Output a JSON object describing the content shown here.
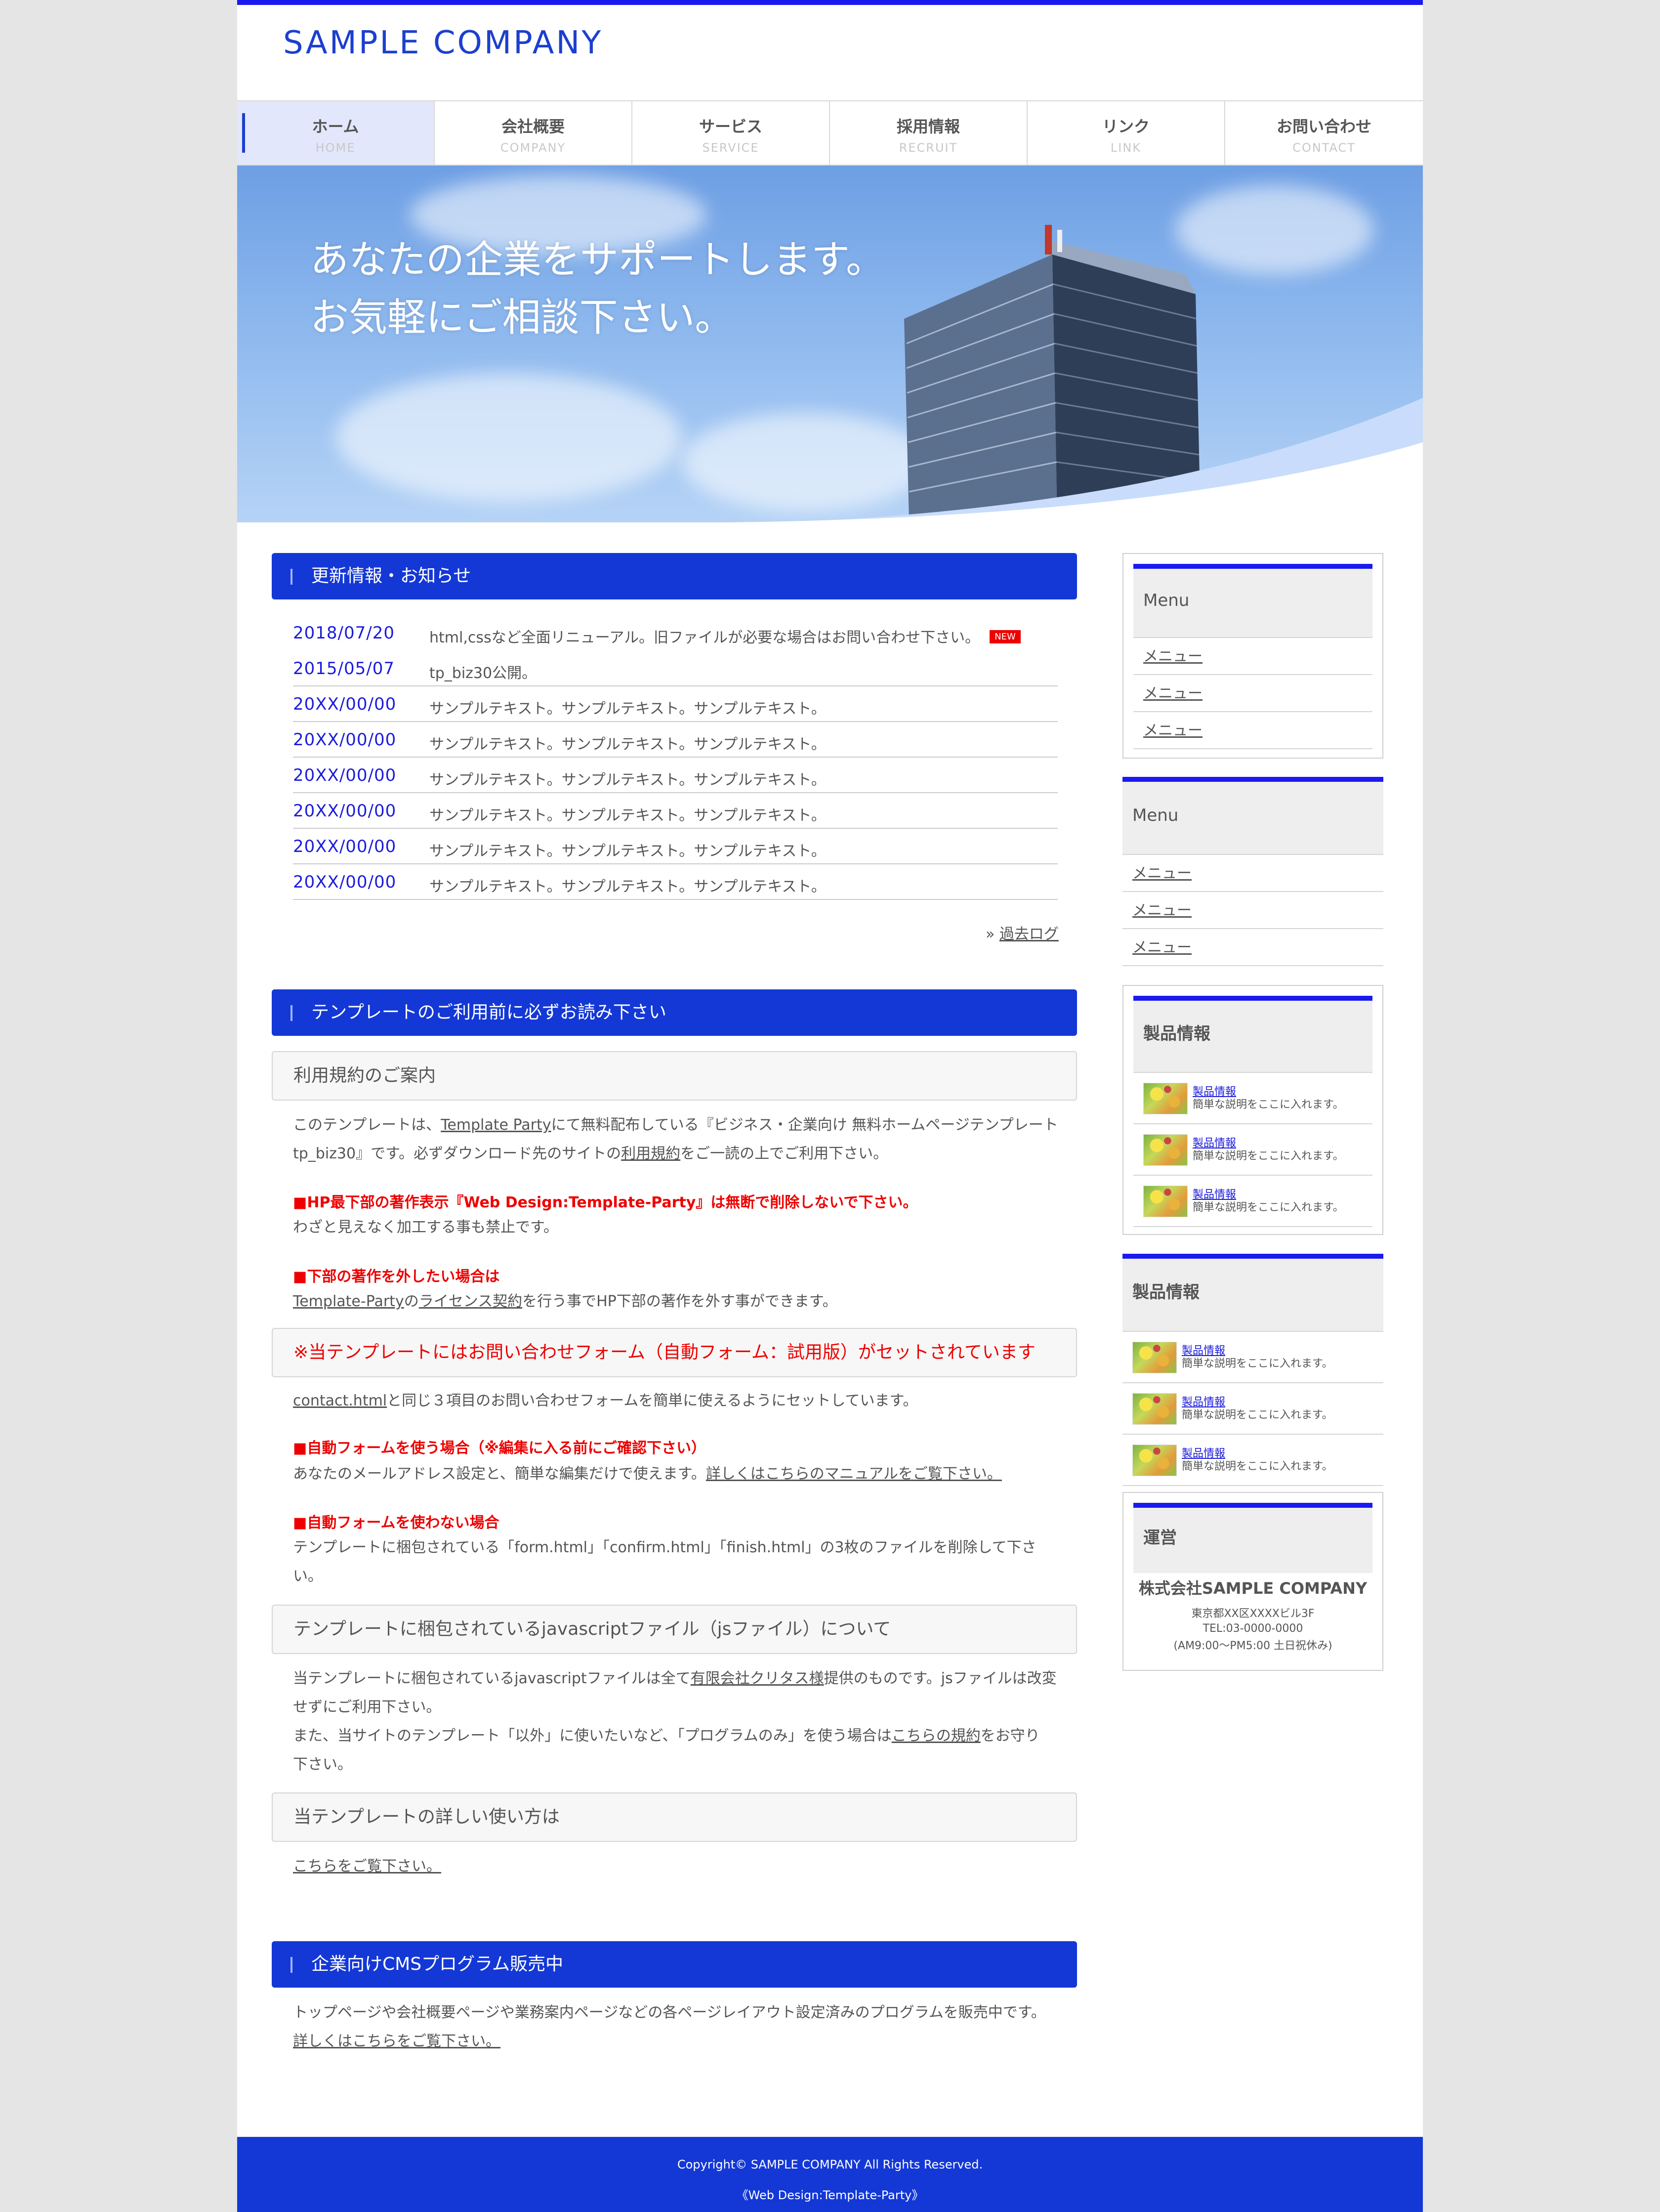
{
  "site": {
    "logo": "SAMPLE COMPANY",
    "accent": "#1438d6"
  },
  "nav": [
    {
      "jp": "ホーム",
      "en": "HOME"
    },
    {
      "jp": "会社概要",
      "en": "COMPANY"
    },
    {
      "jp": "サービス",
      "en": "SERVICE"
    },
    {
      "jp": "採用情報",
      "en": "RECRUIT"
    },
    {
      "jp": "リンク",
      "en": "LINK"
    },
    {
      "jp": "お問い合わせ",
      "en": "CONTACT"
    }
  ],
  "hero": {
    "line1": "あなたの企業をサポートします。",
    "line2": "お気軽にご相談下さい。"
  },
  "news": {
    "title": "更新情報・お知らせ",
    "items": [
      {
        "date": "2018/07/20",
        "text": "html,cssなど全面リニューアル。旧ファイルが必要な場合はお問い合わせ下さい。",
        "badge": "NEW"
      },
      {
        "date": "2015/05/07",
        "text": "tp_biz30公開。"
      },
      {
        "date": "20XX/00/00",
        "text": "サンプルテキスト。サンプルテキスト。サンプルテキスト。"
      },
      {
        "date": "20XX/00/00",
        "text": "サンプルテキスト。サンプルテキスト。サンプルテキスト。"
      },
      {
        "date": "20XX/00/00",
        "text": "サンプルテキスト。サンプルテキスト。サンプルテキスト。"
      },
      {
        "date": "20XX/00/00",
        "text": "サンプルテキスト。サンプルテキスト。サンプルテキスト。"
      },
      {
        "date": "20XX/00/00",
        "text": "サンプルテキスト。サンプルテキスト。サンプルテキスト。"
      },
      {
        "date": "20XX/00/00",
        "text": "サンプルテキスト。サンプルテキスト。サンプルテキスト。"
      }
    ],
    "past_prefix": "»",
    "past_link": "過去ログ"
  },
  "template": {
    "title": "テンプレートのご利用前に必ずお読み下さい",
    "terms_title": "利用規約のご案内",
    "terms_p1_a": "このテンプレートは、",
    "terms_p1_link1": "Template Party",
    "terms_p1_b": "にて無料配布している『ビジネス・企業向け 無料ホームページテンプレート",
    "terms_p1_c": "tp_biz30』です。必ずダウンロード先のサイトの",
    "terms_p1_link2": "利用規約",
    "terms_p1_d": "をご一読の上でご利用下さい。",
    "warn1": "■HP最下部の著作表示『Web Design:Template-Party』は無断で削除しないで下さい。",
    "warn1_text": "わざと見えなく加工する事も禁止です。",
    "warn2": "■下部の著作を外したい場合は",
    "warn2_link1": "Template-Party",
    "warn2_mid": "の",
    "warn2_link2": "ライセンス契約",
    "warn2_text": "を行う事でHP下部の著作を外す事ができます。",
    "form_title": "※当テンプレートにはお問い合わせフォーム（自動フォーム：試用版）がセットされています",
    "form_link": "contact.html",
    "form_text": "と同じ３項目のお問い合わせフォームを簡単に使えるようにセットしています。",
    "auto_use": "■自動フォームを使う場合（※編集に入る前にご確認下さい）",
    "auto_use_text": "あなたのメールアドレス設定と、簡単な編集だけで使えます。",
    "auto_use_link": "詳しくはこちらのマニュアルをご覧下さい。",
    "auto_nouse": "■自動フォームを使わない場合",
    "auto_nouse_text1": "テンプレートに梱包されている「form.html」「confirm.html」「finish.html」の3枚のファイルを削除して下さ",
    "auto_nouse_text2": "い。",
    "js_title": "テンプレートに梱包されているjavascriptファイル（jsファイル）について",
    "js_p1_a": "当テンプレートに梱包されているjavascriptファイルは全て",
    "js_p1_link": "有限会社クリタス様",
    "js_p1_b": "提供のものです。jsファイルは改変",
    "js_p1_c": "せずにご利用下さい。",
    "js_p2_a": "また、当サイトのテンプレート「以外」に使いたいなど、「プログラムのみ」を使う場合は",
    "js_p2_link": "こちらの規約",
    "js_p2_b": "をお守り",
    "js_p2_c": "下さい。",
    "howto_title": "当テンプレートの詳しい使い方は",
    "howto_link": "こちらをご覧下さい。"
  },
  "cms": {
    "title": "企業向けCMSプログラム販売中",
    "text": "トップページや会社概要ページや業務案内ページなどの各ページレイアウト設定済みのプログラムを販売中です。",
    "link": "詳しくはこちらをご覧下さい。"
  },
  "sidebar": {
    "menu1": {
      "title": "Menu",
      "items": [
        "メニュー",
        "メニュー",
        "メニュー"
      ]
    },
    "menu2": {
      "title": "Menu",
      "items": [
        "メニュー",
        "メニュー",
        "メニュー"
      ]
    },
    "prod1": {
      "title": "製品情報",
      "items": [
        {
          "name": "製品情報",
          "desc": "簡単な説明をここに入れます。"
        },
        {
          "name": "製品情報",
          "desc": "簡単な説明をここに入れます。"
        },
        {
          "name": "製品情報",
          "desc": "簡単な説明をここに入れます。"
        }
      ]
    },
    "prod2": {
      "title": "製品情報",
      "items": [
        {
          "name": "製品情報",
          "desc": "簡単な説明をここに入れます。"
        },
        {
          "name": "製品情報",
          "desc": "簡単な説明をここに入れます。"
        },
        {
          "name": "製品情報",
          "desc": "簡単な説明をここに入れます。"
        }
      ]
    },
    "company": {
      "title": "運営",
      "name": "株式会社SAMPLE COMPANY",
      "address": "東京都XX区XXXXビル3F",
      "tel": "TEL:03-0000-0000",
      "hours": "(AM9:00〜PM5:00 土日祝休み)"
    }
  },
  "footer": {
    "copyright": "Copyright© SAMPLE COMPANY All Rights Reserved.",
    "credit": "《Web Design:Template-Party》"
  }
}
